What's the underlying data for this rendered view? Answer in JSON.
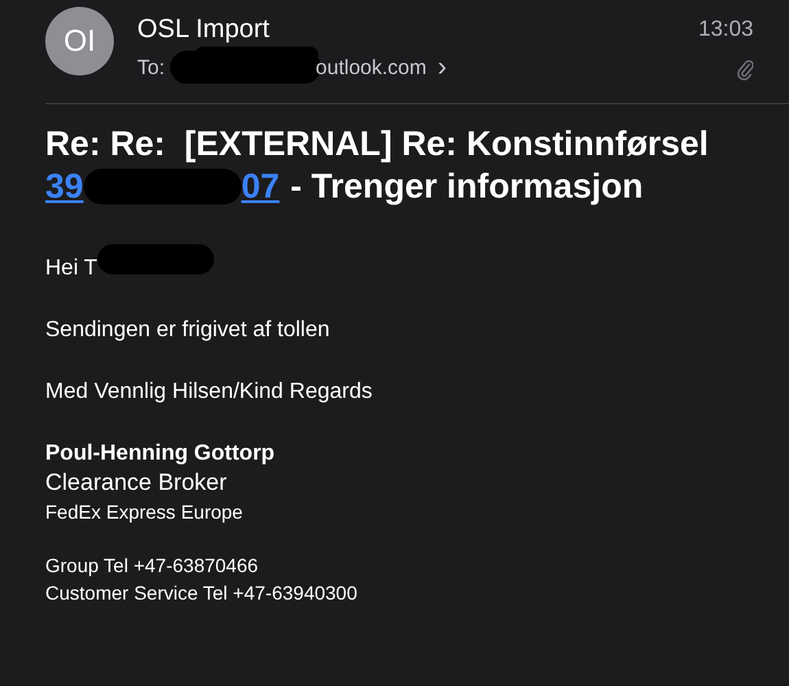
{
  "header": {
    "avatar": "OI",
    "sender": "OSL Import",
    "to_label": "To:",
    "recipient": "outlook.com",
    "chevron": "›",
    "time": "13:03",
    "has_attachment": true
  },
  "subject": {
    "prefix": "Re: Re:  [EXTERNAL] Re: Konstinnførsel",
    "link_parts": [
      "39",
      "07"
    ],
    "suffix": "- Trenger informasjon"
  },
  "body": [
    {
      "kind": "greeting",
      "text": "Hei T"
    },
    {
      "kind": "paragraph",
      "text": "Sendingen er frigivet af tollen"
    },
    {
      "kind": "paragraph",
      "text": "Med Vennlig Hilsen/Kind Regards"
    }
  ],
  "signature": [
    {
      "kind": "name",
      "text": "Poul-Henning Gottorp"
    },
    {
      "kind": "title",
      "text": "Clearance Broker"
    },
    {
      "kind": "small",
      "text": "FedEx Express Europe"
    },
    {
      "kind": "gap",
      "text": "Group Tel +47-63870466"
    },
    {
      "kind": "small",
      "text": "Customer Service Tel +47-63940300"
    }
  ]
}
